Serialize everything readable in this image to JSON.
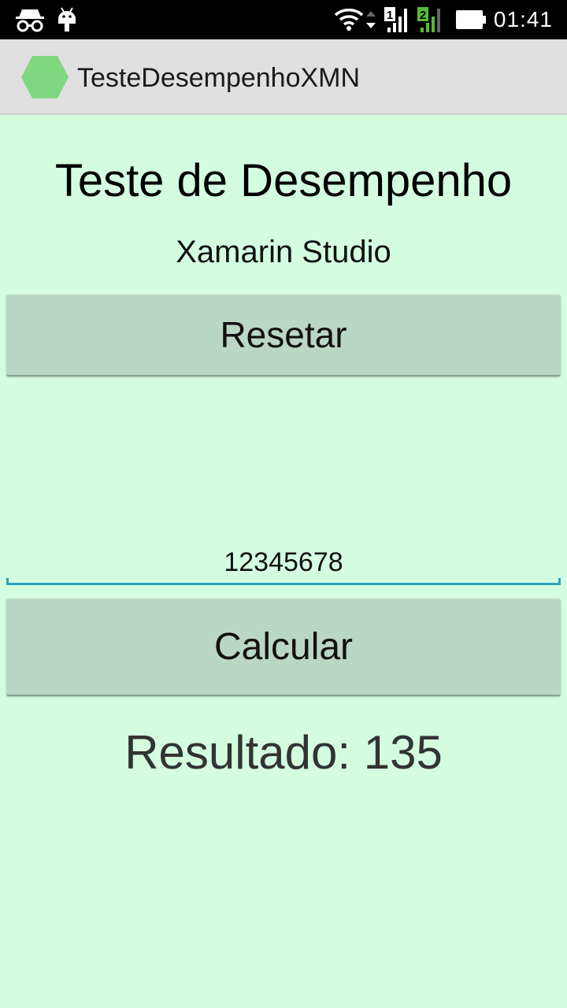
{
  "status_bar": {
    "time": "01:41",
    "icons": [
      "incognito-icon",
      "android-icon",
      "wifi-icon",
      "data-arrows-icon",
      "signal-sim1-icon",
      "signal-sim2-icon",
      "battery-icon"
    ],
    "sim1_label": "1",
    "sim2_label": "2"
  },
  "action_bar": {
    "title": "TesteDesempenhoXMN",
    "icon_color": "#7fd87f"
  },
  "main": {
    "heading": "Teste de Desempenho",
    "subheading": "Xamarin Studio",
    "reset_label": "Resetar",
    "input_value": "12345678",
    "calculate_label": "Calcular",
    "result_text": "Resultado: 135"
  },
  "colors": {
    "background": "#d4fde0",
    "button": "#bad7c5",
    "input_accent": "#2aa3c6"
  }
}
